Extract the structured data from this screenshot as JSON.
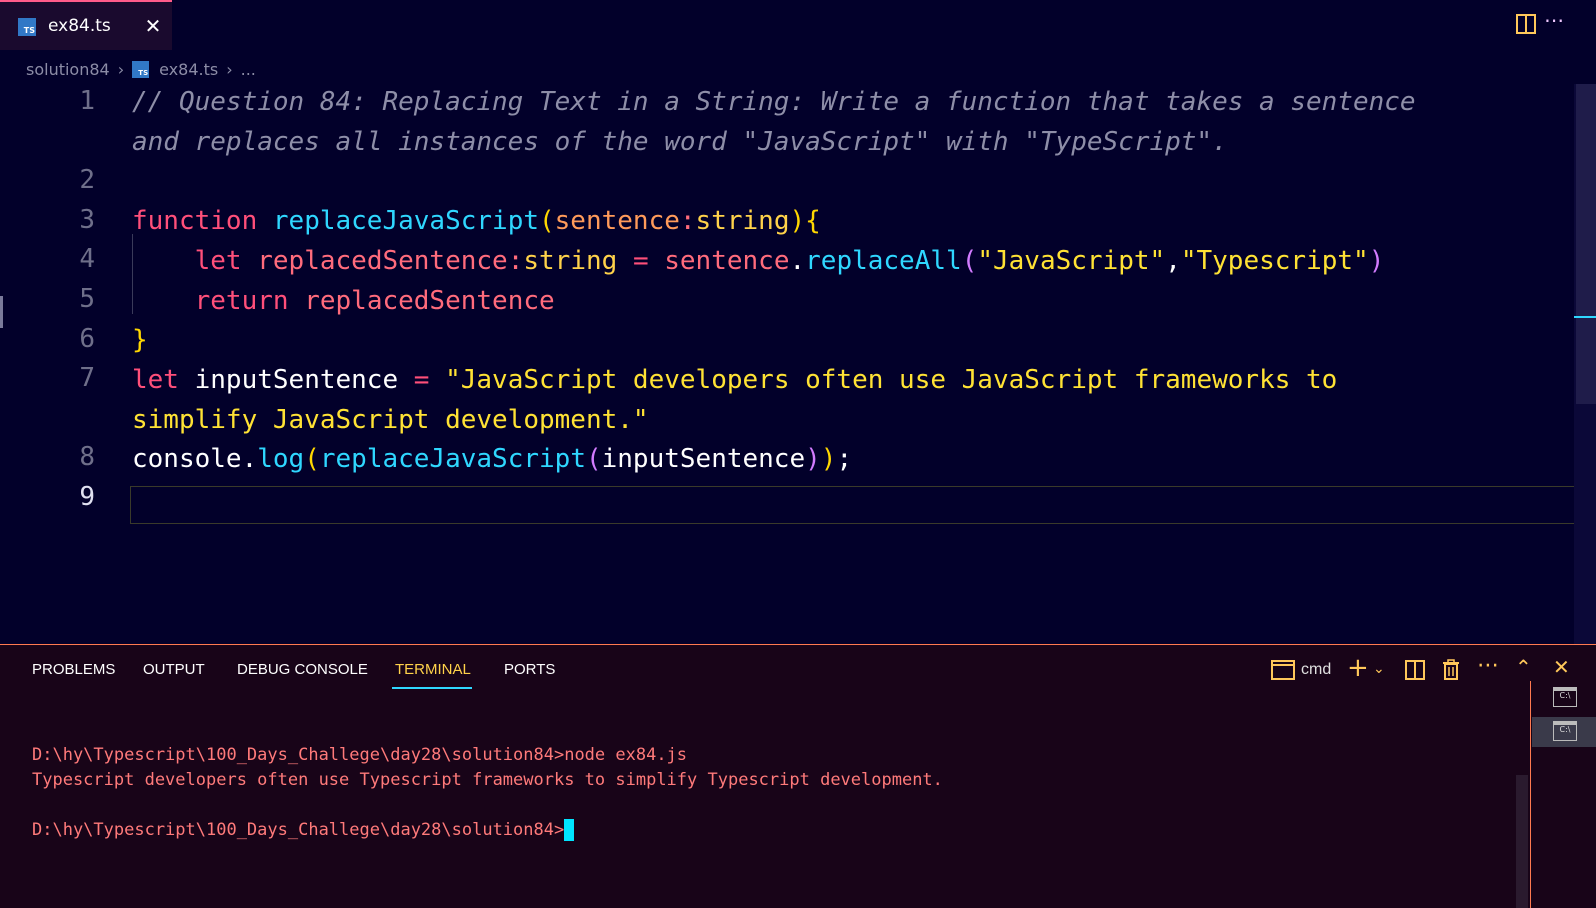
{
  "tab": {
    "filename": "ex84.ts",
    "icon": "typescript-file-icon",
    "close": "✕"
  },
  "breadcrumb": {
    "folder": "solution84",
    "file": "ex84.ts",
    "more": "..."
  },
  "editor": {
    "line_numbers": [
      "1",
      "2",
      "3",
      "4",
      "5",
      "6",
      "7",
      "8",
      "9"
    ],
    "comment_line1": "// Question 84: Replacing Text in a String: Write a function that takes a sentence",
    "comment_line2": "and replaces all instances of the word \"JavaScript\" with \"TypeScript\".",
    "code": {
      "kw_function": "function",
      "fn_name": "replaceJavaScript",
      "param": "sentence",
      "type_string": "string",
      "kw_let": "let",
      "var_replaced": "replacedSentence",
      "eq": "=",
      "var_sentence": "sentence",
      "method_replaceAll": "replaceAll",
      "str_js": "\"JavaScript\"",
      "str_ts": "\"Typescript\"",
      "kw_return": "return",
      "var_input": "inputSentence",
      "str_input1": "\"JavaScript developers often use JavaScript frameworks to",
      "str_input2": "simplify JavaScript development.\"",
      "console": "console",
      "method_log": "log"
    }
  },
  "panel": {
    "tabs": [
      "PROBLEMS",
      "OUTPUT",
      "DEBUG CONSOLE",
      "TERMINAL",
      "PORTS"
    ],
    "active_tab": "TERMINAL",
    "shell": "cmd",
    "terminal_lines": [
      "D:\\hy\\Typescript\\100_Days_Challege\\day28\\solution84>node ex84.js",
      "Typescript developers often use Typescript frameworks to simplify Typescript development.",
      "D:\\hy\\Typescript\\100_Days_Challege\\day28\\solution84>"
    ]
  },
  "colors": {
    "background": "#02002a",
    "keyword": "#ff4f7a",
    "function": "#2fd7ff",
    "string": "#ffe234",
    "terminal_text": "#ff7a7a",
    "active_tab": "#ffd24a"
  }
}
